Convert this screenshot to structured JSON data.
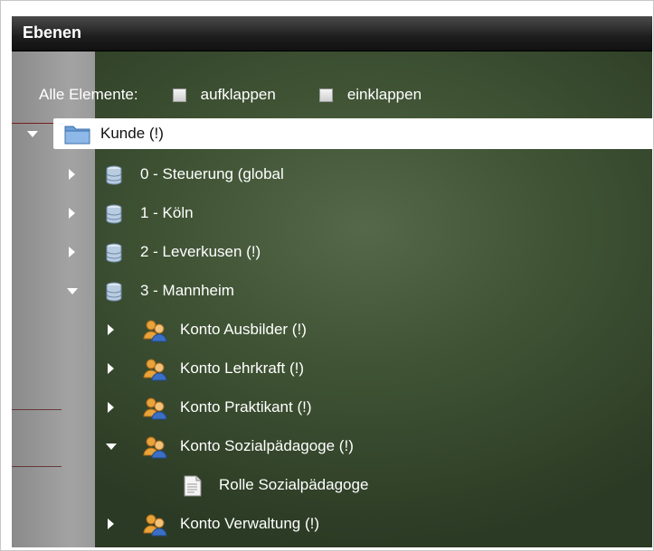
{
  "panel": {
    "title": "Ebenen"
  },
  "controls": {
    "label": "Alle Elemente:",
    "expand_label": "aufklappen",
    "collapse_label": "einklappen"
  },
  "tree": {
    "root": {
      "label": "Kunde (!)",
      "icon": "folder-icon",
      "expanded": true
    },
    "nodes": [
      {
        "label": "0 - Steuerung (global",
        "icon": "database-icon",
        "expanded": false
      },
      {
        "label": "1 - Köln",
        "icon": "database-icon",
        "expanded": false
      },
      {
        "label": "2 - Leverkusen (!)",
        "icon": "database-icon",
        "expanded": false
      },
      {
        "label": "3 - Mannheim",
        "icon": "database-icon",
        "expanded": true
      },
      {
        "label": "Konto Ausbilder (!)",
        "icon": "users-icon",
        "expanded": false
      },
      {
        "label": "Konto Lehrkraft (!)",
        "icon": "users-icon",
        "expanded": false
      },
      {
        "label": "Konto Praktikant (!)",
        "icon": "users-icon",
        "expanded": false
      },
      {
        "label": "Konto Sozialpädagoge (!)",
        "icon": "users-icon",
        "expanded": true
      },
      {
        "label": "Rolle Sozialpädagoge",
        "icon": "document-icon",
        "expanded": false
      },
      {
        "label": "Konto Verwaltung (!)",
        "icon": "users-icon",
        "expanded": false
      }
    ]
  }
}
